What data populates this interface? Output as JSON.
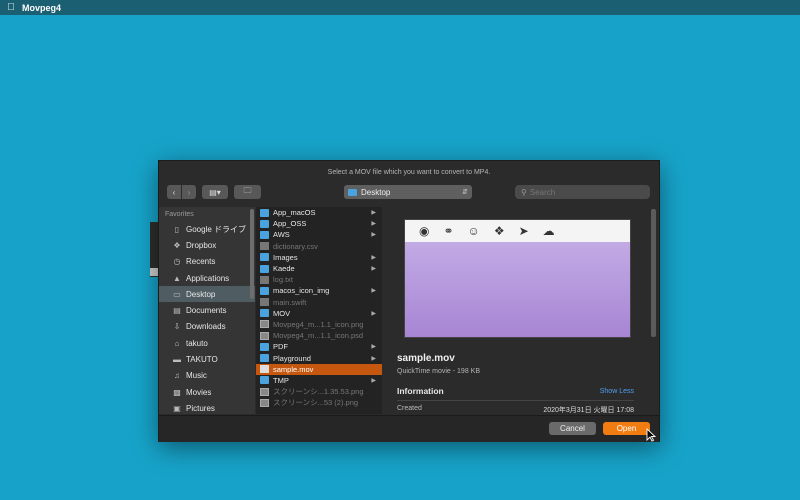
{
  "menubar": {
    "app_name": "Movpeg4",
    "apple_icon": "apple-icon"
  },
  "dialog": {
    "title": "Select a MOV file which you want to convert to MP4.",
    "path": "Desktop",
    "search_placeholder": "Search",
    "sidebar": {
      "header": "Favorites",
      "items": [
        {
          "label": "Google ドライブ",
          "icon": "google-drive-icon"
        },
        {
          "label": "Dropbox",
          "icon": "dropbox-icon"
        },
        {
          "label": "Recents",
          "icon": "clock-icon"
        },
        {
          "label": "Applications",
          "icon": "applications-icon"
        },
        {
          "label": "Desktop",
          "icon": "desktop-icon"
        },
        {
          "label": "Documents",
          "icon": "documents-icon"
        },
        {
          "label": "Downloads",
          "icon": "download-icon"
        },
        {
          "label": "takuto",
          "icon": "home-icon"
        },
        {
          "label": "TAKUTO",
          "icon": "disk-icon"
        },
        {
          "label": "Music",
          "icon": "music-icon"
        },
        {
          "label": "Movies",
          "icon": "movies-icon"
        },
        {
          "label": "Pictures",
          "icon": "pictures-icon"
        }
      ]
    },
    "files": [
      {
        "name": "App_macOS",
        "type": "folder"
      },
      {
        "name": "App_OSS",
        "type": "folder"
      },
      {
        "name": "AWS",
        "type": "folder"
      },
      {
        "name": "dictionary.csv",
        "type": "doc"
      },
      {
        "name": "Images",
        "type": "folder"
      },
      {
        "name": "Kaede",
        "type": "folder"
      },
      {
        "name": "log.txt",
        "type": "doc"
      },
      {
        "name": "macos_icon_img",
        "type": "folder"
      },
      {
        "name": "main.swift",
        "type": "doc"
      },
      {
        "name": "MOV",
        "type": "folder"
      },
      {
        "name": "Movpeg4_m...1.1_icon.png",
        "type": "img"
      },
      {
        "name": "Movpeg4_m...1.1_icon.psd",
        "type": "img"
      },
      {
        "name": "PDF",
        "type": "folder"
      },
      {
        "name": "Playground",
        "type": "folder"
      },
      {
        "name": "sample.mov",
        "type": "movie"
      },
      {
        "name": "TMP",
        "type": "folder"
      },
      {
        "name": "スクリーンシ...1.35.53.png",
        "type": "img"
      },
      {
        "name": "スクリーンシ...53 (2).png",
        "type": "img"
      }
    ],
    "preview": {
      "name": "sample.mov",
      "kind": "QuickTime movie - 198 KB",
      "info_header": "Information",
      "show_less": "Show Less",
      "created_label": "Created",
      "created_value": "2020年3月31日 火曜日 17:08"
    },
    "cancel_label": "Cancel",
    "open_label": "Open"
  },
  "colors": {
    "desktop_bg": "#17a3c9",
    "accent_orange": "#f07c12",
    "selection_orange": "#c5570f",
    "link_blue": "#4ea1f0"
  }
}
